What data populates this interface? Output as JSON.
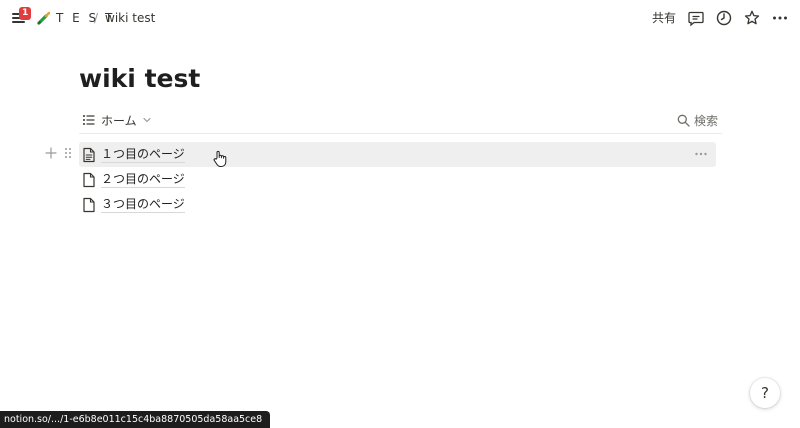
{
  "topbar": {
    "notification_count": "1",
    "workspace_name": "T E S T",
    "separator": "/",
    "page_name": "wiki test",
    "share_label": "共有"
  },
  "page": {
    "title": "wiki test"
  },
  "view": {
    "tab_label": "ホーム",
    "search_label": "検索"
  },
  "pages": [
    {
      "title": "１つ目のページ"
    },
    {
      "title": "２つ目のページ"
    },
    {
      "title": "３つ目のページ"
    }
  ],
  "help": {
    "label": "?"
  },
  "status_bar": {
    "url": "notion.so/.../1-e6b8e011c15c4ba8870505da58aa5ce8"
  },
  "colors": {
    "badge": "#e03e3e",
    "hover_row": "#efefef",
    "text": "#37352f"
  },
  "icons": {
    "menu": "hamburger-icon",
    "workspace": "paint-tube-icon",
    "comments": "comment-icon",
    "updates": "clock-icon",
    "favorite": "star-icon",
    "more": "ellipsis-icon",
    "page": "document-icon",
    "list": "list-icon",
    "search": "search-icon"
  }
}
